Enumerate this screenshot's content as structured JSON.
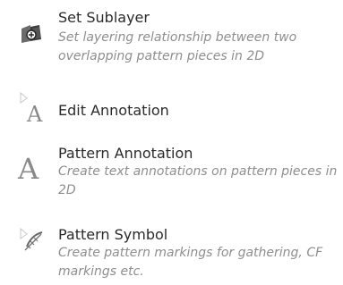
{
  "items": [
    {
      "title": "Set Sublayer",
      "description": "Set layering relationship between two overlapping pattern pieces in 2D",
      "icon": "sublayer-icon"
    },
    {
      "title": "Edit Annotation",
      "description": "",
      "icon": "edit-annotation-icon"
    },
    {
      "title": "Pattern Annotation",
      "description": "Create text annotations on pattern pieces in 2D",
      "icon": "pattern-annotation-icon"
    },
    {
      "title": "Pattern Symbol",
      "description": "Create pattern markings for gathering, CF markings etc.",
      "icon": "pattern-symbol-icon"
    }
  ]
}
